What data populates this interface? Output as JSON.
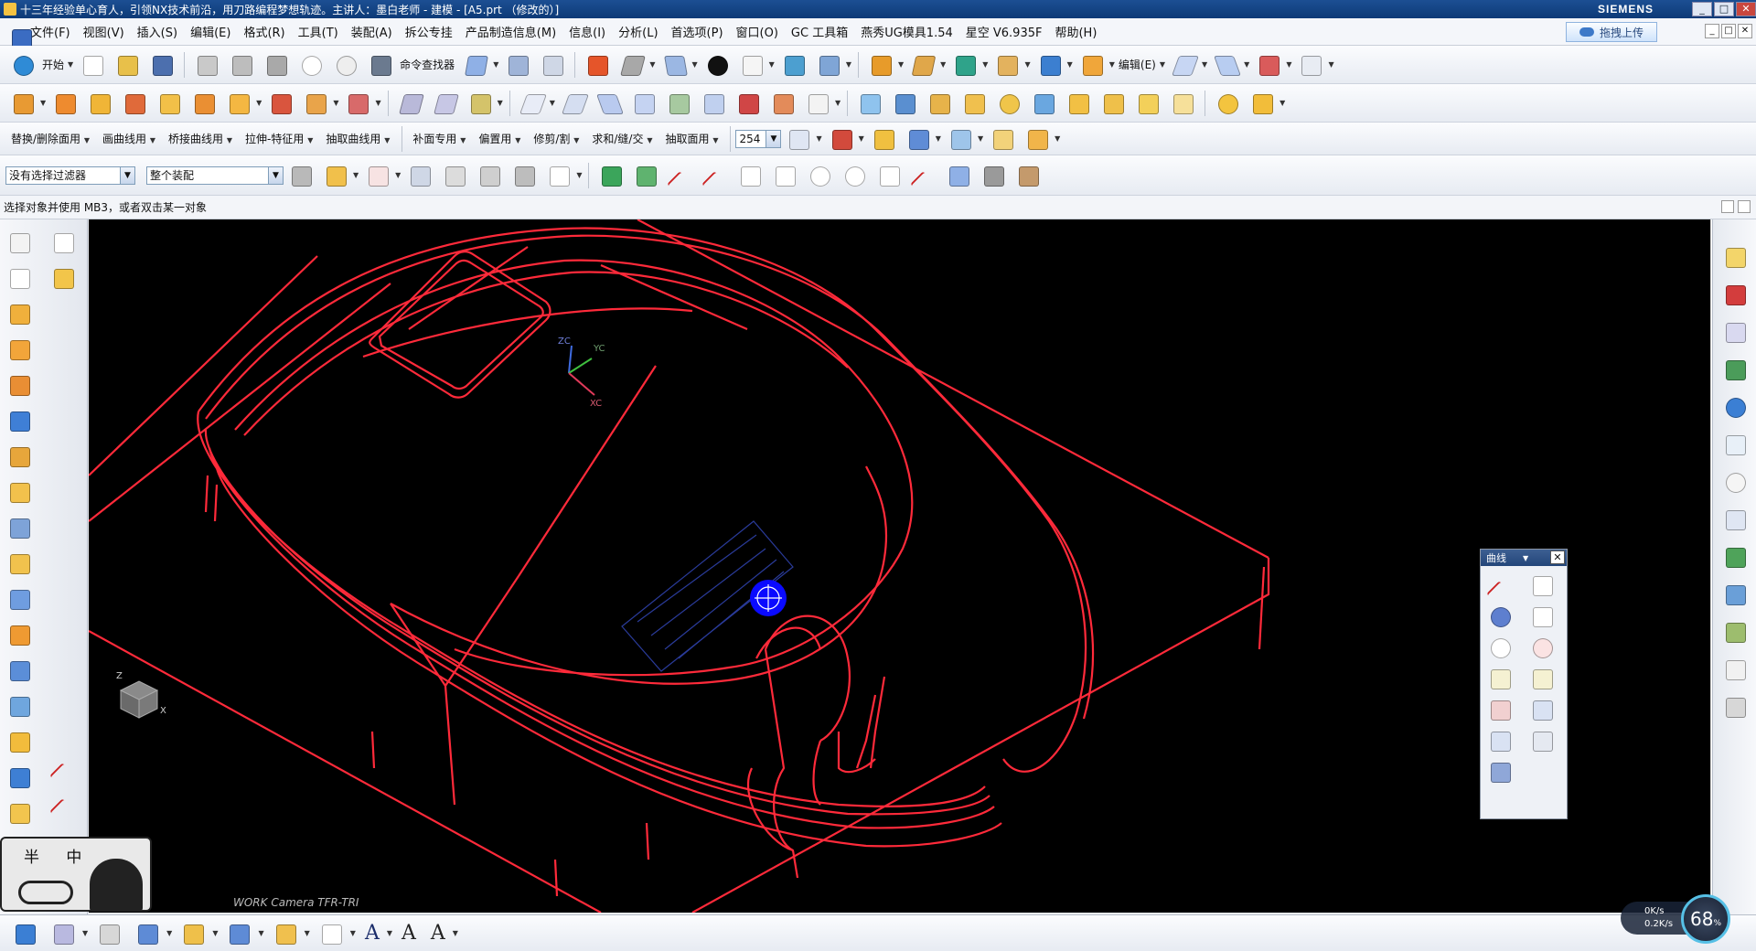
{
  "window": {
    "title": "十三年经验单心育人，引领NX技术前沿，用刀路编程梦想轨迹。主讲人：墨白老师 - 建模 - [A5.prt （修改的）]",
    "brand": "SIEMENS",
    "controls": [
      "_",
      "□",
      "✕"
    ]
  },
  "menubar": {
    "items": [
      "文件(F)",
      "视图(V)",
      "插入(S)",
      "编辑(E)",
      "格式(R)",
      "工具(T)",
      "装配(A)",
      "拆公专挂",
      "产品制造信息(M)",
      "信息(I)",
      "分析(L)",
      "首选项(P)",
      "窗口(O)",
      "GC 工具箱",
      "燕秀UG模具1.54",
      "星空 V6.935F",
      "帮助(H)"
    ],
    "upload_label": "拖拽上传"
  },
  "toolbar1": {
    "start_label": "开始",
    "command_finder_label": "命令查找器",
    "edit_label": "编辑(E)"
  },
  "toolbar3": {
    "items": [
      "替换/删除面用",
      "画曲线用",
      "桥接曲线用",
      "拉伸-特征用",
      "抽取曲线用",
      "补面专用",
      "偏置用",
      "修剪/割",
      "求和/缝/交",
      "抽取面用"
    ],
    "layer_value": "254"
  },
  "selectionbar": {
    "filter_value": "没有选择过滤器",
    "scope_value": "整个装配"
  },
  "cueline": {
    "text": "选择对象并使用 MB3，或者双击某一对象"
  },
  "viewport": {
    "camera_label": "WORK Camera TFR-TRI",
    "triad": {
      "zc": "ZC",
      "yc": "YC",
      "xc": "XC"
    },
    "mini_triad": {
      "z": "Z",
      "x": "X"
    },
    "colors": {
      "background": "#000000",
      "wire": "#ff2a3a",
      "hatch": "#2a3b9a",
      "cursor": "#0a0aff"
    }
  },
  "curve_palette": {
    "title": "曲线",
    "close": "✕"
  },
  "avatar": {
    "text": "半 中"
  },
  "netwidget": {
    "up": "0K/s",
    "down": "0.2K/s",
    "percent": "68",
    "percent_unit": "%"
  }
}
